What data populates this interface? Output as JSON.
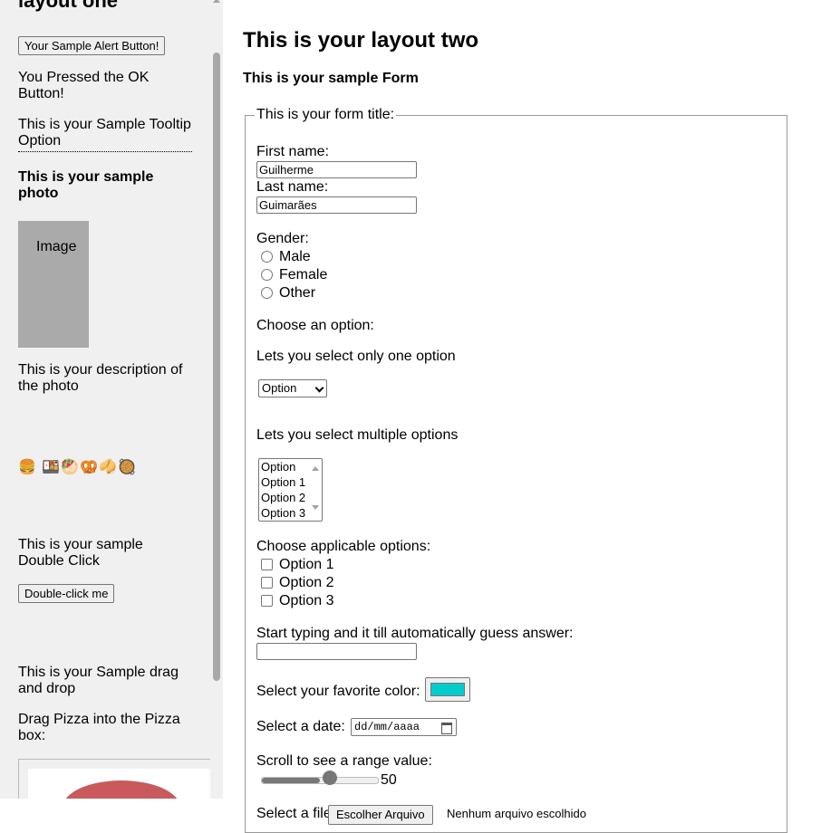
{
  "left": {
    "title": "layout one",
    "alert_button": "Your Sample Alert Button!",
    "alert_result": "You Pressed the OK Button!",
    "tooltip_option": "This is your Sample Tooltip Option",
    "photo_heading": "This is your sample photo",
    "photo_label": "Image",
    "photo_description": "This is your description of the photo",
    "emojis": "🍔 🍱🥙🥨🥠🥘",
    "double_click_text": "This is your sample Double Click",
    "double_click_button": "Double-click me",
    "drag_heading": "This is your Sample drag and drop",
    "drag_instruction": "Drag Pizza into the Pizza box:"
  },
  "right": {
    "title": "This is your layout two",
    "form_heading": "This is your sample Form",
    "form_legend": "This is your form title:",
    "first_name_label": "First name:",
    "first_name_value": "Guilherme",
    "last_name_label": "Last name:",
    "last_name_value": "Guimarães",
    "gender_label": "Gender:",
    "gender_options": [
      "Male",
      "Female",
      "Other"
    ],
    "choose_option_label": "Choose an option:",
    "single_select_label": "Lets you select only one option",
    "single_select_value": "Option",
    "multi_select_label": "Lets you select multiple options",
    "multi_select_options": [
      "Option",
      "Option 1",
      "Option 2",
      "Option 3"
    ],
    "checkbox_label": "Choose applicable options:",
    "checkbox_options": [
      "Option 1",
      "Option 2",
      "Option 3"
    ],
    "autocomplete_label": "Start typing and it till automatically guess answer:",
    "autocomplete_value": "",
    "color_label": "Select your favorite color:",
    "color_value": "#00cccc",
    "date_label": "Select a date:",
    "date_placeholder": "dd/mm/aaaa",
    "range_label": "Scroll to see a range value:",
    "range_value": "50",
    "range_fraction": 0.5,
    "file_label": "Select a file:",
    "file_button": "Escolher Arquivo",
    "file_status": "Nenhum arquivo escolhido"
  },
  "colors": {
    "left_panel_bg": "#f0f0f0",
    "photo_placeholder": "#aaaaaa",
    "pizza": "#c85a5e"
  }
}
